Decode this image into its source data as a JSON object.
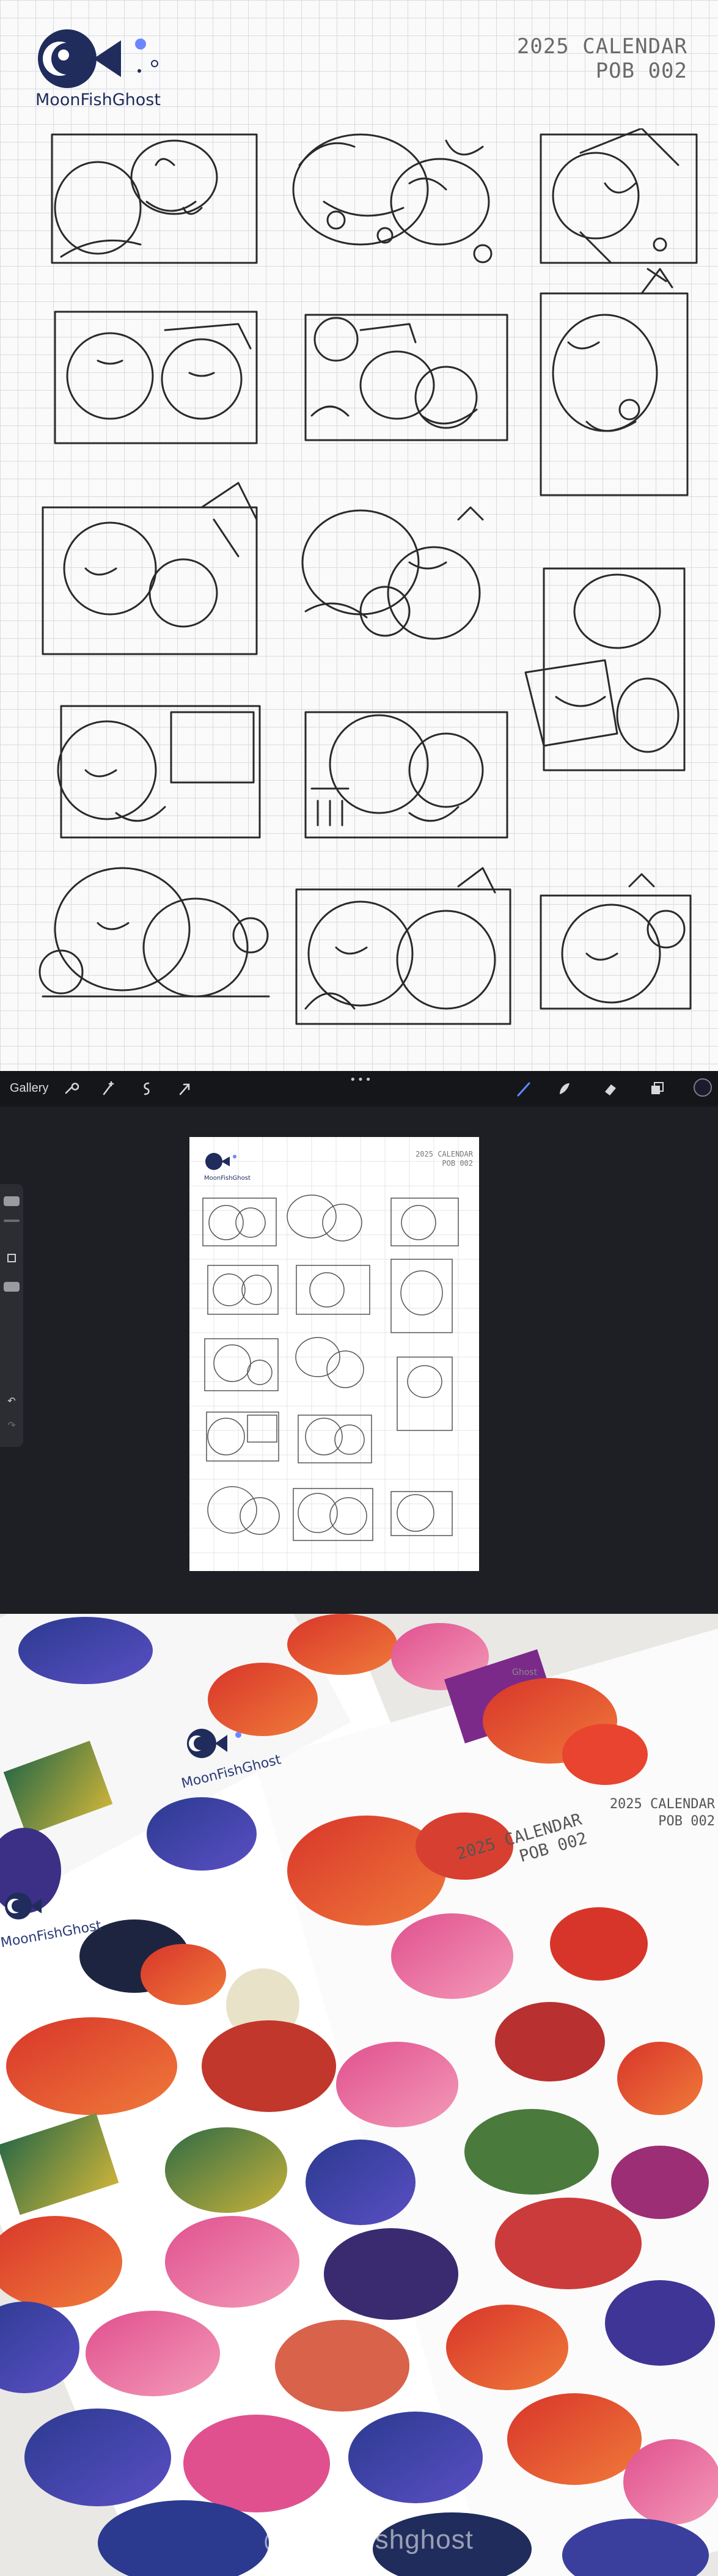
{
  "brand": {
    "name": "MoonFishGhost",
    "colors": {
      "navy": "#1f2c5c",
      "accent_dot": "#6c86ff"
    }
  },
  "sketch_sheet": {
    "title_line1": "2025 CALENDAR",
    "title_line2": "POB 002",
    "sketch_count": 15
  },
  "procreate": {
    "gallery_label": "Gallery",
    "more_icon": "•••",
    "tools": [
      "wrench-icon",
      "magic-wand-icon",
      "selection-icon",
      "transform-arrow-icon"
    ],
    "right_tools": [
      "brush-icon",
      "smudge-icon",
      "eraser-icon",
      "layers-icon",
      "color-well-icon"
    ],
    "side_controls": [
      "brush-size-slider",
      "opacity-slider",
      "modify-button",
      "undo-icon",
      "redo-icon"
    ],
    "canvas": {
      "brand": "MoonFishGhost",
      "title_line1": "2025 CALENDAR",
      "title_line2": "POB 002"
    }
  },
  "photo": {
    "sheet_a": {
      "line1": "2025 CALENDAR",
      "line2": "POB 002"
    },
    "sheet_b": {
      "line1": "2025 CALENDAR",
      "line2": "POB 002"
    },
    "brand_left": "MoonFishGhost",
    "brand_mid": "MoonFishGhost",
    "brand_corner": "Ghost",
    "watermark": "@moonfishghost"
  }
}
